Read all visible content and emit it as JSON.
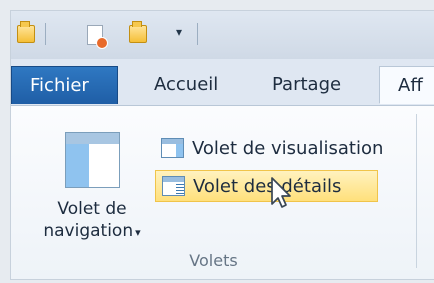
{
  "tabs": {
    "file": "Fichier",
    "home": "Accueil",
    "share": "Partage",
    "view": "Aff"
  },
  "ribbon": {
    "navigation_pane_line1": "Volet de",
    "navigation_pane_line2": "navigation",
    "preview_pane": "Volet de visualisation",
    "details_pane": "Volet des détails",
    "group_label": "Volets"
  },
  "icons": {
    "toolbar": [
      "folder-icon",
      "document-properties-icon",
      "new-folder-icon",
      "customize-icon"
    ],
    "ribbon": [
      "navigation-pane-icon",
      "preview-pane-icon",
      "details-pane-icon"
    ]
  },
  "colors": {
    "file_tab": "#1f5ea6",
    "hover_highlight": "#ffe07b",
    "pane_blue": "#8fc3ef"
  }
}
